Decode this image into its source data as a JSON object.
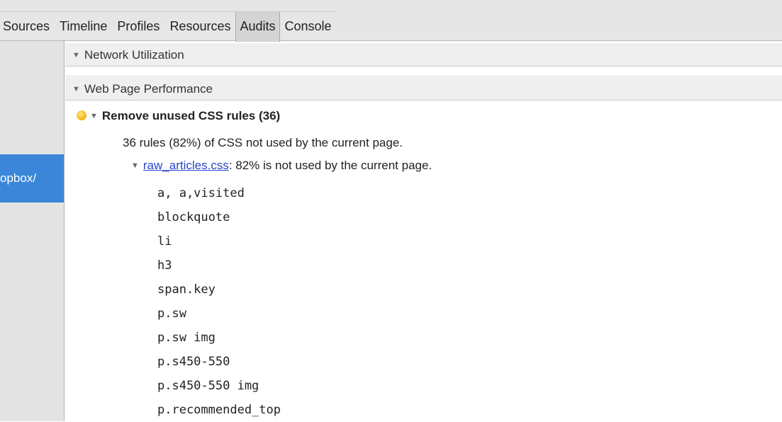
{
  "tabs": [
    "Sources",
    "Timeline",
    "Profiles",
    "Resources",
    "Audits",
    "Console"
  ],
  "active_tab": "Audits",
  "sidebar": {
    "selected_item": "opbox/"
  },
  "sections": [
    {
      "label": "Network Utilization",
      "expanded": true
    },
    {
      "label": "Web Page Performance",
      "expanded": true
    }
  ],
  "rule": {
    "title": "Remove unused CSS rules (36)",
    "severity_color": "#f2b50f",
    "summary": "36 rules (82%) of CSS not used by the current page.",
    "file": {
      "name": "raw_articles.css",
      "message": ": 82% is not used by the current page."
    },
    "selectors": [
      "a, a,visited",
      "blockquote",
      "li",
      "h3",
      "span.key",
      "p.sw",
      "p.sw img",
      "p.s450-550",
      "p.s450-550 img",
      "p.recommended_top"
    ]
  },
  "icons": {
    "expand": "triangle-down-icon",
    "severity": "warning-dot-icon"
  }
}
